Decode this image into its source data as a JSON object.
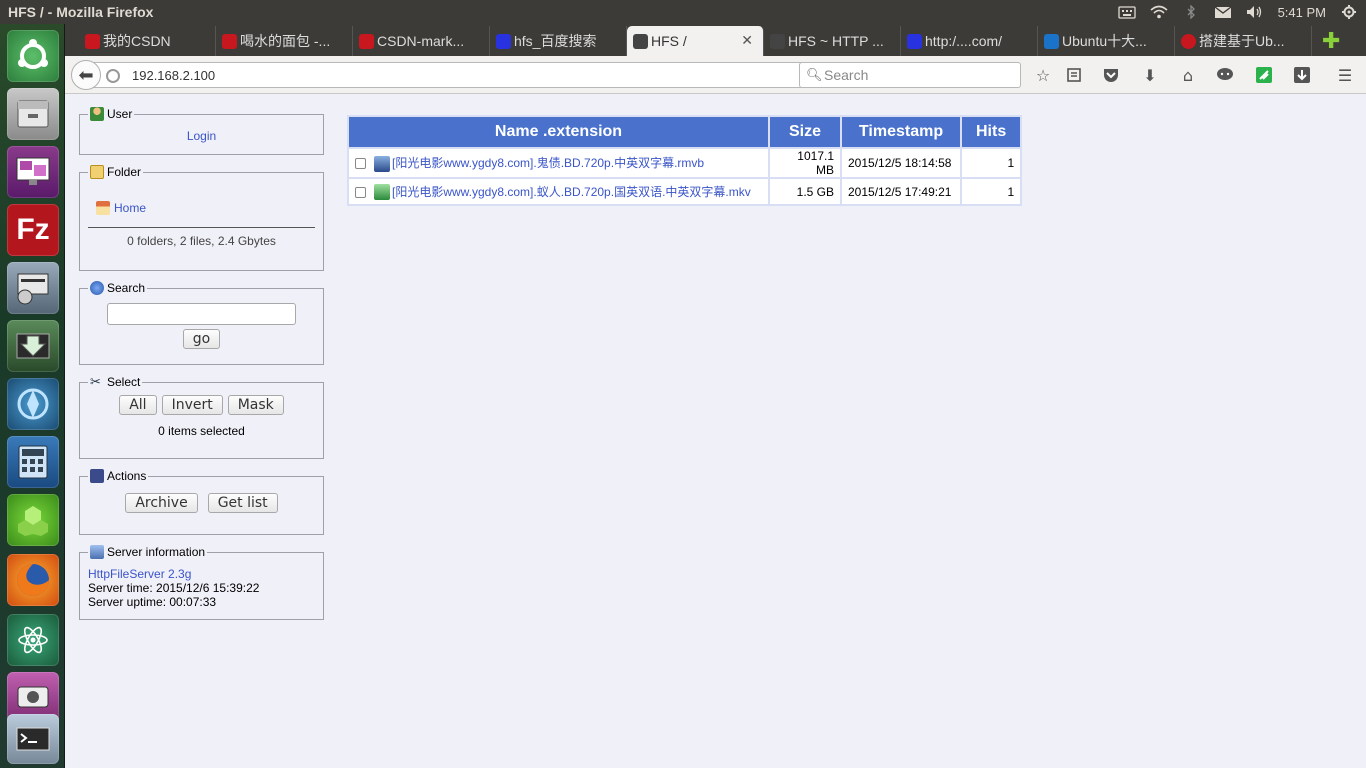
{
  "window": {
    "title": "HFS / - Mozilla Firefox",
    "clock": "5:41 PM"
  },
  "tabs": [
    {
      "label": "我的CSDN",
      "color": "#c8171e"
    },
    {
      "label": "喝水的面包 -...",
      "color": "#c8171e"
    },
    {
      "label": "CSDN-mark...",
      "color": "#c8171e"
    },
    {
      "label": "hfs_百度搜索",
      "color": "#2932e1"
    },
    {
      "label": "HFS /",
      "color": "#333333",
      "active": true
    },
    {
      "label": "HFS ~ HTTP ...",
      "color": "#333333"
    },
    {
      "label": "http:/....com/",
      "color": "#2932e1"
    },
    {
      "label": "Ubuntu十大...",
      "color": "#1a73c8"
    },
    {
      "label": "搭建基于Ub...",
      "color": "#c8171e"
    }
  ],
  "nav": {
    "url": "192.168.2.100",
    "search_placeholder": "Search"
  },
  "panels": {
    "user": {
      "legend": "User",
      "login": "Login"
    },
    "folder": {
      "legend": "Folder",
      "home": "Home",
      "summary": "0 folders, 2 files, 2.4 Gbytes"
    },
    "search": {
      "legend": "Search",
      "go": "go"
    },
    "select": {
      "legend": "Select",
      "all": "All",
      "invert": "Invert",
      "mask": "Mask",
      "selected": "0 items selected"
    },
    "actions": {
      "legend": "Actions",
      "archive": "Archive",
      "getlist": "Get list"
    },
    "server": {
      "legend": "Server information",
      "version": "HttpFileServer 2.3g",
      "time": "Server time: 2015/12/6 15:39:22",
      "uptime": "Server uptime: 00:07:33"
    }
  },
  "table": {
    "headers": {
      "name": "Name .extension",
      "size": "Size",
      "timestamp": "Timestamp",
      "hits": "Hits"
    },
    "rows": [
      {
        "name": "[阳光电影www.ygdy8.com].鬼债.BD.720p.中英双字幕.rmvb",
        "size": "1017.1 MB",
        "timestamp": "2015/12/5 18:14:58",
        "hits": "1",
        "icon": "rmvb-file-icon"
      },
      {
        "name": "[阳光电影www.ygdy8.com].蚁人.BD.720p.国英双语.中英双字幕.mkv",
        "size": "1.5 GB",
        "timestamp": "2015/12/5 17:49:21",
        "hits": "1",
        "icon": "mkv-file-icon"
      }
    ]
  }
}
